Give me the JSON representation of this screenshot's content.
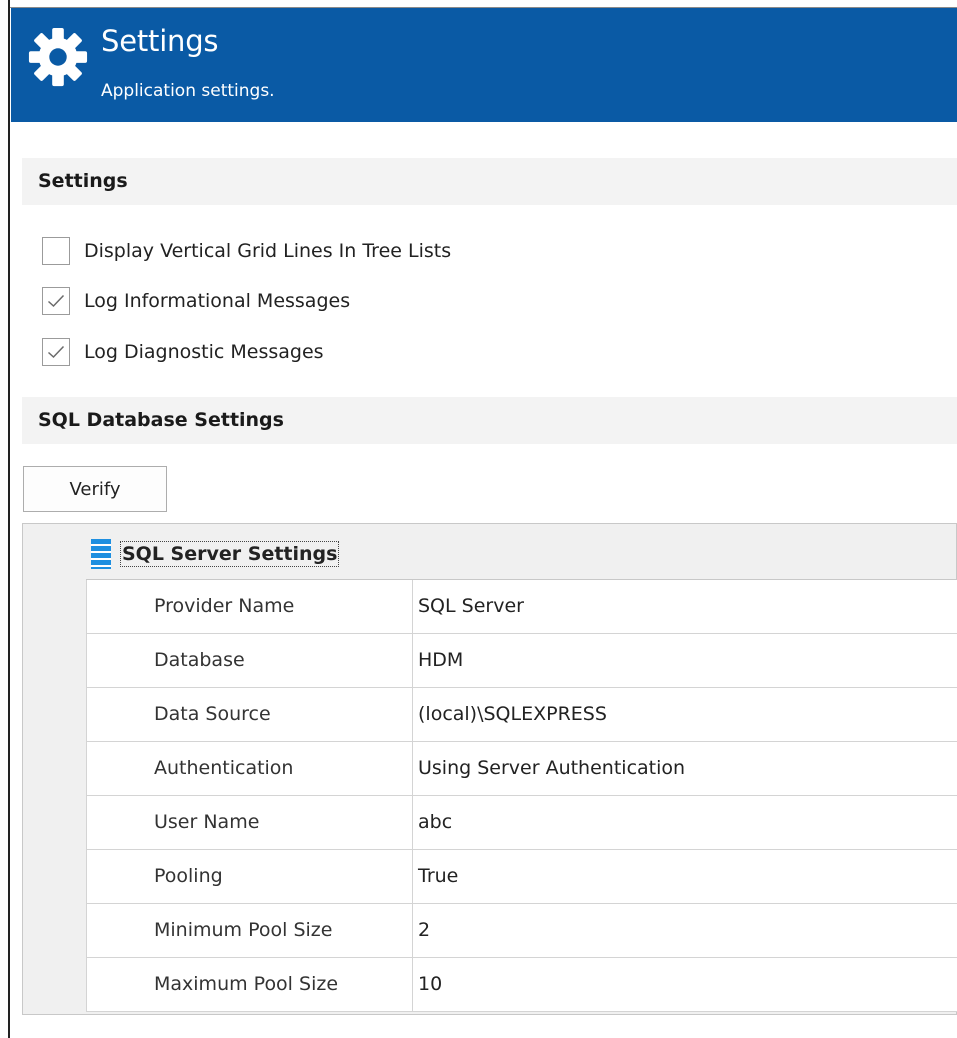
{
  "header": {
    "title": "Settings",
    "subtitle": "Application settings.",
    "icon": "gear-icon",
    "background": "#0a5aa5"
  },
  "settings_section": {
    "title": "Settings",
    "options": [
      {
        "label": "Display Vertical Grid Lines In Tree Lists",
        "checked": false
      },
      {
        "label": "Log Informational Messages",
        "checked": true
      },
      {
        "label": "Log Diagnostic Messages",
        "checked": true
      }
    ]
  },
  "sql_section": {
    "title": "SQL Database Settings",
    "verify_label": "Verify"
  },
  "property_grid": {
    "category": "SQL Server Settings",
    "category_icon": "database-icon",
    "rows": [
      {
        "name": "Provider Name",
        "value": "SQL Server"
      },
      {
        "name": "Database",
        "value": "HDM"
      },
      {
        "name": "Data Source",
        "value": "(local)\\SQLEXPRESS"
      },
      {
        "name": "Authentication",
        "value": "Using Server Authentication"
      },
      {
        "name": "User Name",
        "value": "abc"
      },
      {
        "name": "Pooling",
        "value": "True"
      },
      {
        "name": "Minimum Pool Size",
        "value": "2"
      },
      {
        "name": "Maximum Pool Size",
        "value": "10"
      }
    ]
  }
}
